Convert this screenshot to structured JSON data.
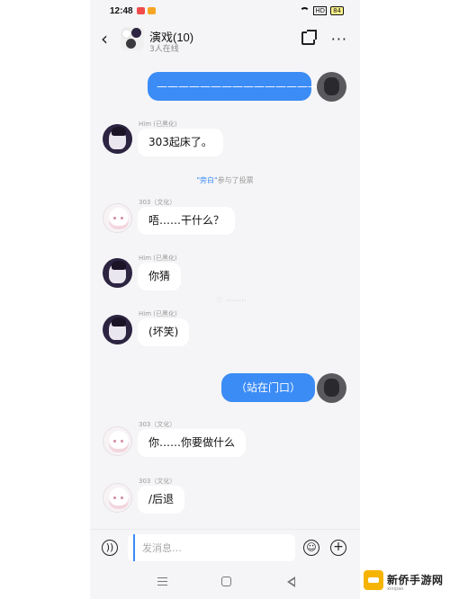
{
  "statusbar": {
    "time": "12:48",
    "signal": "HD",
    "battery": "84"
  },
  "header": {
    "back_glyph": "‹",
    "title": "演戏(10)",
    "subtitle": "3人在线",
    "more_glyph": "···"
  },
  "messages": {
    "m1": {
      "text": "———————————————"
    },
    "m2": {
      "sender": "Him (已黑化)",
      "text": "303起床了。"
    },
    "system": {
      "name": "\"旁白\"",
      "text": "参与了投票"
    },
    "m3": {
      "sender": "303（文化）",
      "text": "唔……干什么？"
    },
    "m4": {
      "sender": "Him (已黑化)",
      "text": "你猜"
    },
    "m5": {
      "sender": "Him (已黑化)",
      "text": "(坏笑)"
    },
    "m6": {
      "text": "（站在门口）"
    },
    "m7": {
      "sender": "303（文化）",
      "text": "你……你要做什么"
    },
    "m8": {
      "sender": "303（文化）",
      "text": "/后退"
    }
  },
  "input": {
    "placeholder": "发消息…"
  },
  "logo": {
    "text": "新侨手游网",
    "sub": "xinqiao"
  },
  "colors": {
    "accent": "#3b8cf5",
    "background": "#f5f5f7"
  },
  "icons": [
    "wifi-icon",
    "back-icon",
    "share-icon",
    "more-icon",
    "voice-icon",
    "emoji-icon",
    "plus-icon",
    "nav-menu-icon",
    "nav-home-icon",
    "nav-back-icon"
  ]
}
